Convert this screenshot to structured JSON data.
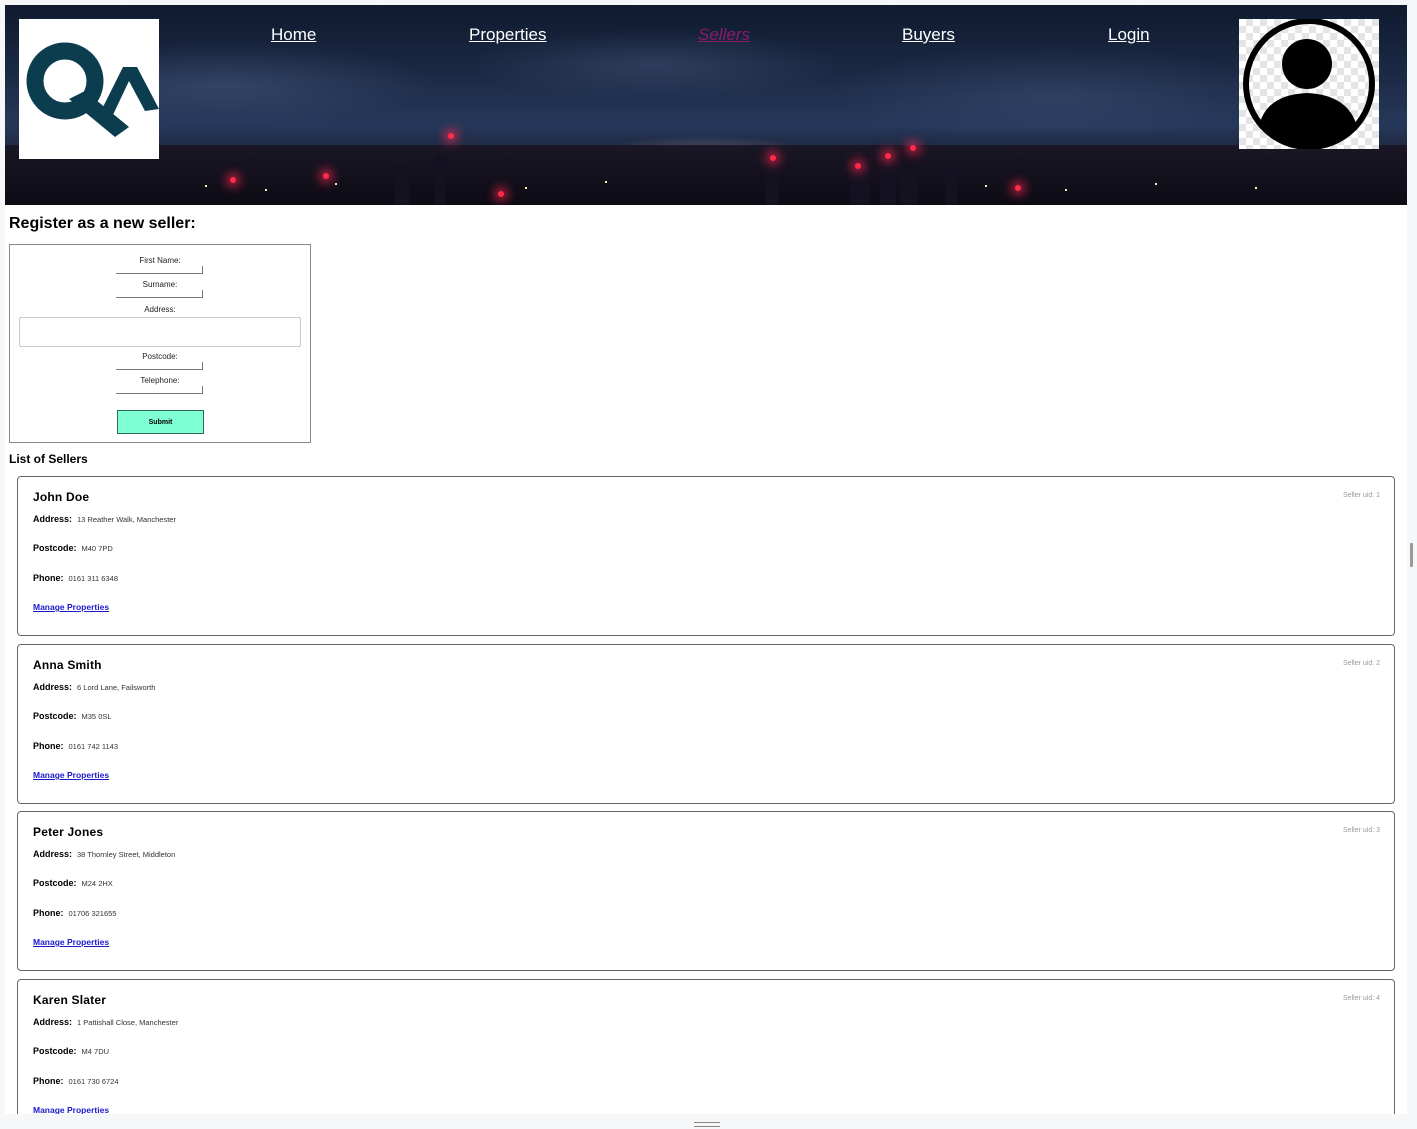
{
  "nav": {
    "home": "Home",
    "properties": "Properties",
    "sellers": "Sellers",
    "buyers": "Buyers",
    "login": "Login"
  },
  "form": {
    "title": "Register as a new seller:",
    "first_name_label": "First Name:",
    "surname_label": "Surname:",
    "address_label": "Address:",
    "postcode_label": "Postcode:",
    "telephone_label": "Telephone:",
    "submit_label": "Submit"
  },
  "list": {
    "title": "List of Sellers",
    "address_label": "Address:",
    "postcode_label": "Postcode:",
    "phone_label": "Phone:",
    "manage_label": "Manage Properties",
    "sellers": [
      {
        "name": "John Doe",
        "uid": "Seller uid: 1",
        "address": "13 Reather Walk, Manchester",
        "postcode": "M40 7PD",
        "phone": "0161 311 6348"
      },
      {
        "name": "Anna Smith",
        "uid": "Seller uid: 2",
        "address": "6 Lord Lane, Failsworth",
        "postcode": "M35 0SL",
        "phone": "0161 742 1143"
      },
      {
        "name": "Peter Jones",
        "uid": "Seller uid: 3",
        "address": "38 Thornley Street, Middleton",
        "postcode": "M24 2HX",
        "phone": "01706 321655"
      },
      {
        "name": "Karen Slater",
        "uid": "Seller uid: 4",
        "address": "1 Pattishall Close, Manchester",
        "postcode": "M4 7DU",
        "phone": "0161 730 6724"
      }
    ]
  },
  "colors": {
    "logo": "#0b3d4f",
    "submit_bg": "#7fffd4",
    "active_nav": "#8a1a6a",
    "link": "#1a1acc"
  },
  "icons": {
    "logo": "qa-logo-icon",
    "avatar": "user-avatar-icon"
  }
}
